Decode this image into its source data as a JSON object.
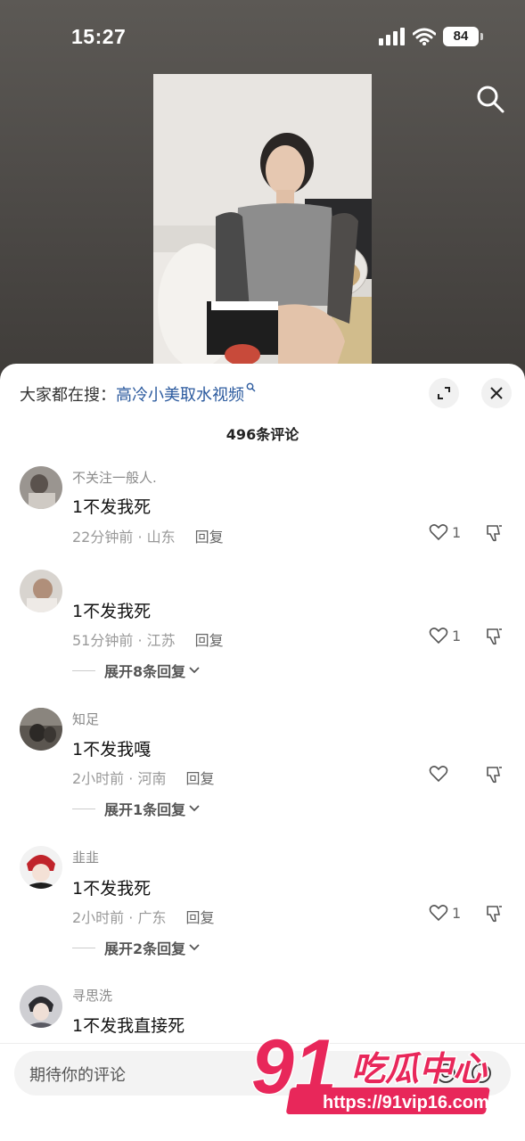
{
  "status": {
    "time": "15:27",
    "battery": "84"
  },
  "sheet": {
    "search_prefix": "大家都在搜：",
    "search_query": "高冷小美取水视频",
    "comment_count": "496条评论"
  },
  "comments": [
    {
      "username": "不关注一般人.",
      "text": "1不发我死",
      "time_location": "22分钟前 · 山东",
      "reply": "回复",
      "likes": "1"
    },
    {
      "username": "",
      "text": "1不发我死",
      "time_location": "51分钟前 · 江苏",
      "reply": "回复",
      "likes": "1",
      "expand": "展开8条回复"
    },
    {
      "username": "知足",
      "text": "1不发我嘎",
      "time_location": "2小时前 · 河南",
      "reply": "回复",
      "likes": "",
      "expand": "展开1条回复"
    },
    {
      "username": "韭韭",
      "text": "1不发我死",
      "time_location": "2小时前 · 广东",
      "reply": "回复",
      "likes": "1",
      "expand": "展开2条回复"
    },
    {
      "username": "寻思洗",
      "text": "1不发我直接死"
    }
  ],
  "input": {
    "placeholder": "期待你的评论"
  },
  "watermark": {
    "brand_number": "91",
    "brand_text": "吃瓜中心",
    "url": "https://91vip16.com"
  },
  "colors": {
    "link": "#2b5a9e",
    "watermark": "#e8275a"
  },
  "icons": [
    "search-icon",
    "expand-icon",
    "close-icon",
    "heart-icon",
    "dislike-icon",
    "chevron-down-icon",
    "at-icon",
    "emoji-icon"
  ]
}
